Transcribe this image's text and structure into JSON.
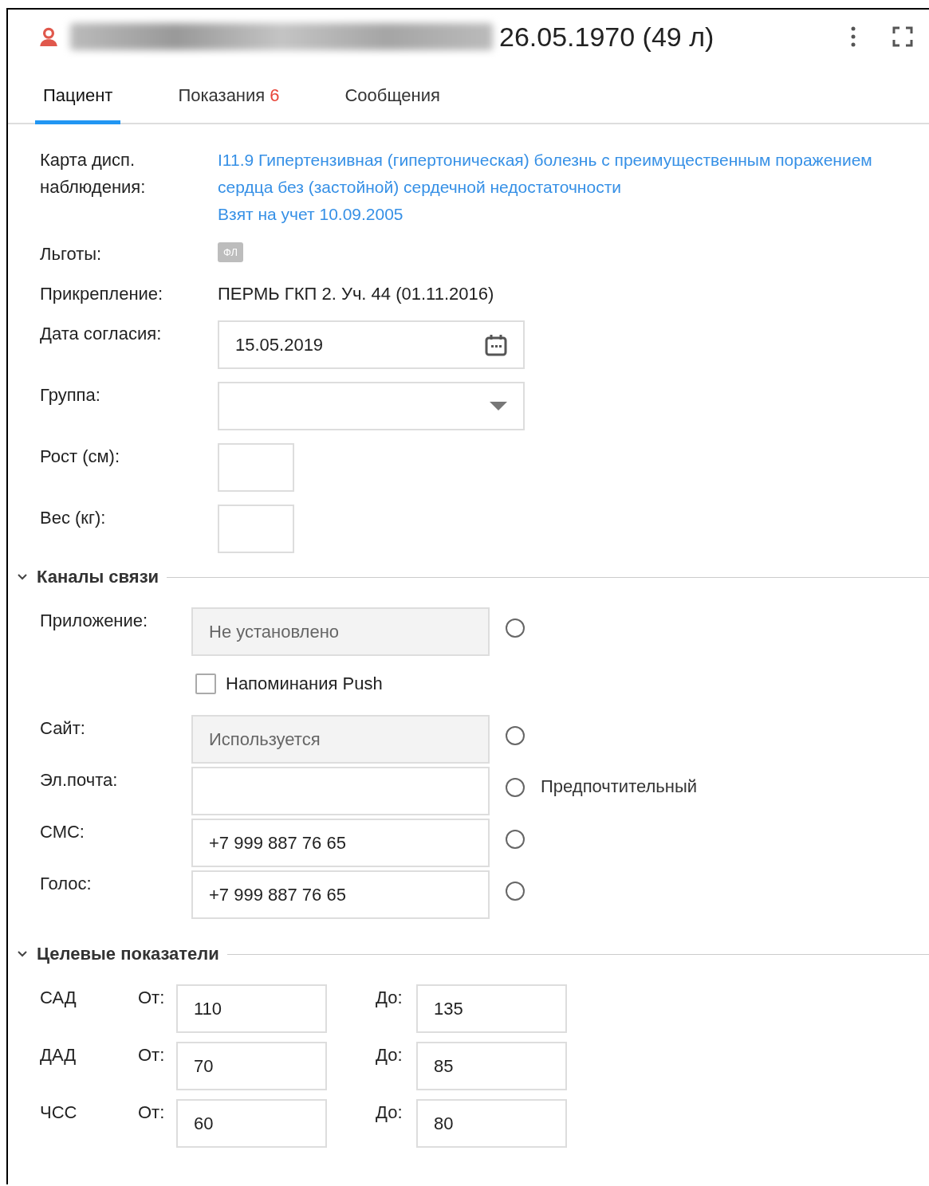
{
  "header": {
    "date": "26.05.1970 (49 л)"
  },
  "tabs": [
    {
      "label": "Пациент",
      "selected": true
    },
    {
      "label": "Показания",
      "badge": "6",
      "selected": false
    },
    {
      "label": "Сообщения",
      "selected": false
    }
  ],
  "patient_fields": [
    {
      "kind": "link",
      "label": "Карта дисп. наблюдения:",
      "lines": [
        "I11.9 Гипертензивная (гипертоническая) болезнь с преимущественным поражением сердца без (застойной) сердечной недостаточности",
        "Взят на учет 10.09.2005"
      ]
    },
    {
      "kind": "badge",
      "label": "Льготы:",
      "value": "ФЛ"
    },
    {
      "kind": "text",
      "label": "Прикрепление:",
      "value": "ПЕРМЬ ГКП 2. Уч. 44 (01.11.2016)"
    },
    {
      "kind": "date",
      "label": "Дата согласия:",
      "value": "15.05.2019"
    },
    {
      "kind": "select",
      "label": "Группа:"
    },
    {
      "kind": "small_input",
      "label": "Рост (см):"
    },
    {
      "kind": "small_input",
      "label": "Вес (кг):"
    }
  ],
  "channels": {
    "title": "Каналы связи",
    "expanded": true,
    "rows": [
      {
        "kind": "field",
        "label": "Приложение:",
        "value": "Не установлено",
        "disabled": true,
        "selected": false
      },
      {
        "kind": "checkbox",
        "text": "Напоминания Push",
        "checked": false
      },
      {
        "kind": "field",
        "label": "Сайт:",
        "value": "Используется",
        "disabled": true,
        "selected": false
      },
      {
        "kind": "field",
        "label": "Эл.почта:",
        "disabled": false,
        "selected": false,
        "note": "Предпочтительный"
      },
      {
        "kind": "field",
        "label": "СМС:",
        "value": "+7 999 887 76 65",
        "disabled": false,
        "selected": false
      },
      {
        "kind": "field",
        "label": "Голос:",
        "value": "+7 999 887 76 65",
        "disabled": false,
        "selected": false
      }
    ]
  },
  "targets": {
    "title": "Целевые показатели",
    "expanded": true,
    "rows": [
      {
        "name": "САД",
        "from_label": "От:",
        "from": "110",
        "to_label": "До:",
        "to": "135"
      },
      {
        "name": "ДАД",
        "from_label": "От:",
        "from": "70",
        "to_label": "До:",
        "to": "85"
      },
      {
        "name": "ЧСС",
        "from_label": "От:",
        "from": "60",
        "to_label": "До:",
        "to": "80"
      }
    ]
  }
}
